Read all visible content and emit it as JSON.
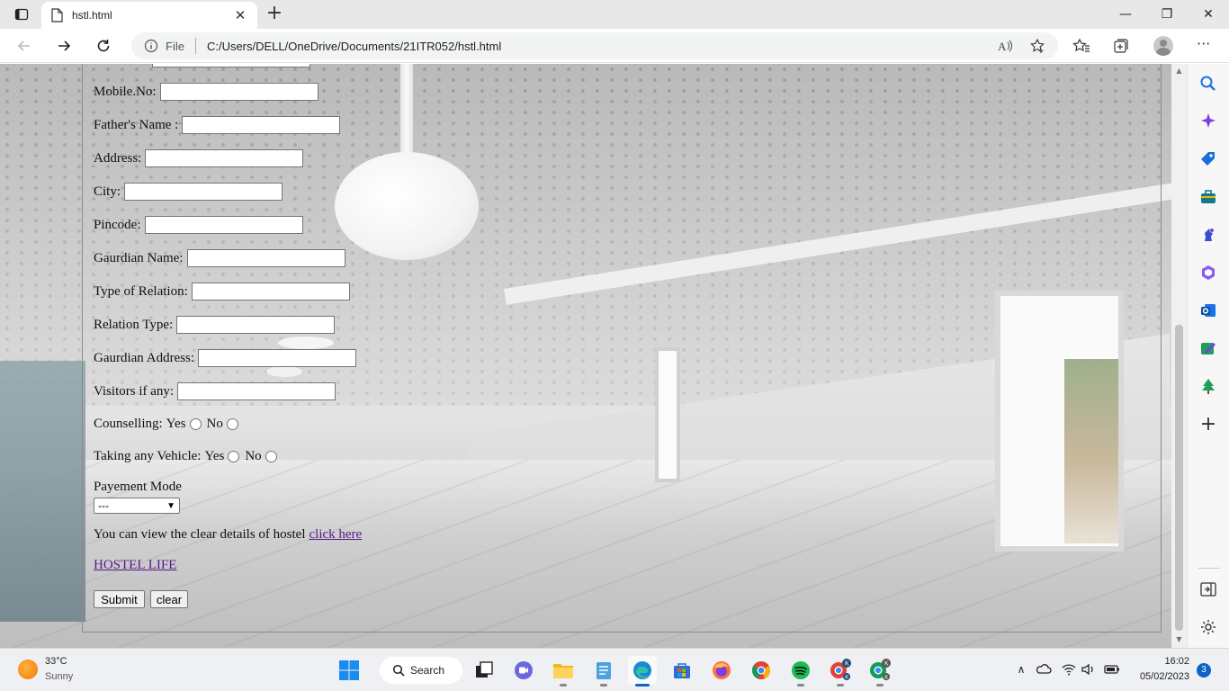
{
  "browser": {
    "tab_title": "hstl.html",
    "scheme_label": "File",
    "url": "C:/Users/DELL/OneDrive/Documents/21ITR052/hstl.html"
  },
  "form": {
    "fields": [
      {
        "label": "Mobile.No:",
        "value": ""
      },
      {
        "label": "Father's Name :",
        "value": ""
      },
      {
        "label": "Address:",
        "value": ""
      },
      {
        "label": "City:",
        "value": ""
      },
      {
        "label": "Pincode:",
        "value": ""
      },
      {
        "label": "Gaurdian Name:",
        "value": ""
      },
      {
        "label": "Type of Relation:",
        "value": ""
      },
      {
        "label": "Relation Type:",
        "value": ""
      },
      {
        "label": "Gaurdian Address:",
        "value": ""
      },
      {
        "label": "Visitors if any:",
        "value": ""
      }
    ],
    "counselling": {
      "label": "Counselling:",
      "yes": "Yes",
      "no": "No"
    },
    "vehicle": {
      "label": "Taking any Vehicle:",
      "yes": "Yes",
      "no": "No"
    },
    "payment": {
      "label": "Payement Mode",
      "selected": "---"
    },
    "details_text": "You can view the clear details of hostel",
    "details_link": "click here",
    "hostel_link": "HOSTEL LIFE",
    "submit_label": "Submit",
    "clear_label": "clear"
  },
  "taskbar": {
    "temperature": "33°C",
    "weather": "Sunny",
    "search_label": "Search",
    "time": "16:02",
    "date": "05/02/2023",
    "notification_count": "3"
  }
}
